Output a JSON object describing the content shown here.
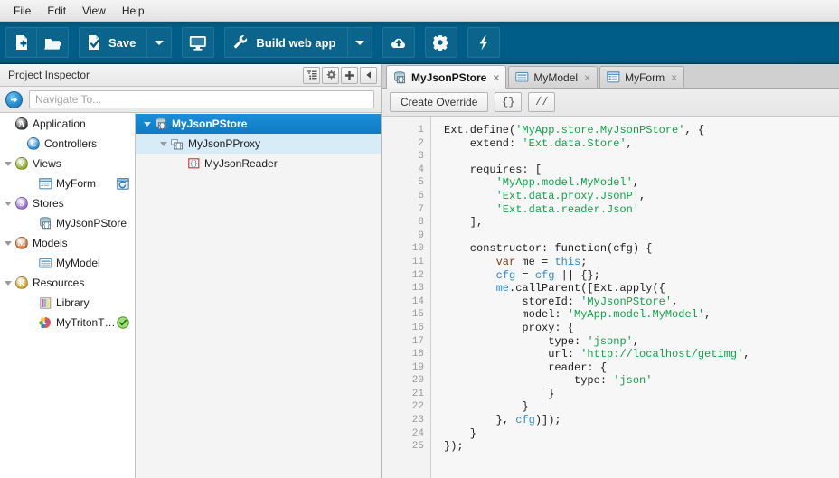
{
  "menubar": {
    "items": [
      "File",
      "Edit",
      "View",
      "Help"
    ]
  },
  "toolbar": {
    "groups": [
      {
        "buttons": [
          {
            "name": "new-file-button",
            "icon": "new-file-icon",
            "label": ""
          },
          {
            "name": "open-folder-button",
            "icon": "open-folder-icon",
            "label": ""
          }
        ]
      },
      {
        "buttons": [
          {
            "name": "save-button",
            "icon": "save-icon",
            "label": "Save"
          },
          {
            "name": "save-dropdown-button",
            "icon": "chevron-down-icon",
            "label": ""
          }
        ]
      },
      {
        "buttons": [
          {
            "name": "preview-button",
            "icon": "monitor-icon",
            "label": ""
          }
        ]
      },
      {
        "buttons": [
          {
            "name": "build-button",
            "icon": "wrench-icon",
            "label": "Build web app"
          },
          {
            "name": "build-dropdown-button",
            "icon": "chevron-down-icon",
            "label": ""
          }
        ]
      },
      {
        "buttons": [
          {
            "name": "deploy-button",
            "icon": "cloud-upload-icon",
            "label": ""
          }
        ]
      },
      {
        "buttons": [
          {
            "name": "settings-button",
            "icon": "gear-icon",
            "label": ""
          }
        ]
      },
      {
        "buttons": [
          {
            "name": "run-button",
            "icon": "lightning-icon",
            "label": ""
          }
        ]
      }
    ],
    "save_label": "Save",
    "build_label": "Build web app"
  },
  "inspector": {
    "title": "Project Inspector",
    "tools": [
      {
        "name": "filter-list-icon",
        "tip": "Filter"
      },
      {
        "name": "gear-icon",
        "tip": "Settings"
      },
      {
        "name": "plus-icon",
        "tip": "Add"
      },
      {
        "name": "collapse-left-icon",
        "tip": "Collapse"
      }
    ],
    "navigate": {
      "go_icon": "arrow-right-circle-icon",
      "placeholder": "Navigate To...",
      "value": ""
    },
    "tree": [
      {
        "label": "Application",
        "icon_letter": "A",
        "icon_color": "#3b3b3b",
        "indent": 0,
        "twisty": false,
        "type": "app"
      },
      {
        "label": "Controllers",
        "icon_letter": "C",
        "icon_color": "#2f8ed6",
        "indent": 1,
        "twisty": false,
        "type": "folder"
      },
      {
        "label": "Views",
        "icon_letter": "V",
        "icon_color": "#8fae24",
        "indent": 0,
        "twisty": true,
        "type": "folder"
      },
      {
        "label": "MyForm",
        "icon_letter": "",
        "icon_color": "",
        "indent": 2,
        "twisty": false,
        "type": "view",
        "badge": "refresh-window-icon"
      },
      {
        "label": "Stores",
        "icon_letter": "S",
        "icon_color": "#9b6fd0",
        "indent": 0,
        "twisty": true,
        "type": "folder"
      },
      {
        "label": "MyJsonPStore",
        "icon_letter": "",
        "icon_color": "",
        "indent": 2,
        "twisty": false,
        "type": "store"
      },
      {
        "label": "Models",
        "icon_letter": "M",
        "icon_color": "#cf7434",
        "indent": 0,
        "twisty": true,
        "type": "folder"
      },
      {
        "label": "MyModel",
        "icon_letter": "",
        "icon_color": "",
        "indent": 2,
        "twisty": false,
        "type": "model"
      },
      {
        "label": "Resources",
        "icon_letter": "R",
        "icon_color": "#cfa52a",
        "indent": 0,
        "twisty": true,
        "type": "folder"
      },
      {
        "label": "Library",
        "icon_letter": "",
        "icon_color": "",
        "indent": 2,
        "twisty": false,
        "type": "library"
      },
      {
        "label": "MyTritonThe...",
        "icon_letter": "",
        "icon_color": "",
        "indent": 2,
        "twisty": false,
        "type": "theme",
        "badge": "check-circle-icon"
      }
    ],
    "detail_tree": [
      {
        "label": "MyJsonPStore",
        "indent": 0,
        "twisty": true,
        "state": "selected",
        "icon": "store-icon"
      },
      {
        "label": "MyJsonPProxy",
        "indent": 1,
        "twisty": true,
        "state": "hover",
        "icon": "proxy-icon"
      },
      {
        "label": "MyJsonReader",
        "indent": 2,
        "twisty": false,
        "state": "normal",
        "icon": "reader-icon"
      }
    ]
  },
  "editor": {
    "tabs": [
      {
        "label": "MyJsonPStore",
        "icon": "store-icon",
        "active": true,
        "close": "×"
      },
      {
        "label": "MyModel",
        "icon": "model-icon",
        "active": false,
        "close": "×"
      },
      {
        "label": "MyForm",
        "icon": "view-icon",
        "active": false,
        "close": "×"
      }
    ],
    "toolbar": {
      "create_override": "Create Override",
      "braces": "{}",
      "comment": "//"
    },
    "line_count": 25,
    "line_numbers": [
      1,
      2,
      3,
      4,
      5,
      6,
      7,
      8,
      9,
      10,
      11,
      12,
      13,
      14,
      15,
      16,
      17,
      18,
      19,
      20,
      21,
      22,
      23,
      24,
      25
    ],
    "code_lines": [
      [
        {
          "t": "Ext.define(",
          "c": "p"
        },
        {
          "t": "'MyApp.store.MyJsonPStore'",
          "c": "s"
        },
        {
          "t": ", {",
          "c": "p"
        }
      ],
      [
        {
          "t": "    extend: ",
          "c": "p"
        },
        {
          "t": "'Ext.data.Store'",
          "c": "s"
        },
        {
          "t": ",",
          "c": "p"
        }
      ],
      [
        {
          "t": "",
          "c": "p"
        }
      ],
      [
        {
          "t": "    requires: [",
          "c": "p"
        }
      ],
      [
        {
          "t": "        ",
          "c": "p"
        },
        {
          "t": "'MyApp.model.MyModel'",
          "c": "s"
        },
        {
          "t": ",",
          "c": "p"
        }
      ],
      [
        {
          "t": "        ",
          "c": "p"
        },
        {
          "t": "'Ext.data.proxy.JsonP'",
          "c": "s"
        },
        {
          "t": ",",
          "c": "p"
        }
      ],
      [
        {
          "t": "        ",
          "c": "p"
        },
        {
          "t": "'Ext.data.reader.Json'",
          "c": "s"
        }
      ],
      [
        {
          "t": "    ],",
          "c": "p"
        }
      ],
      [
        {
          "t": "",
          "c": "p"
        }
      ],
      [
        {
          "t": "    constructor: function(cfg) {",
          "c": "p"
        }
      ],
      [
        {
          "t": "        ",
          "c": "p"
        },
        {
          "t": "var",
          "c": "k"
        },
        {
          "t": " me = ",
          "c": "p"
        },
        {
          "t": "this",
          "c": "v"
        },
        {
          "t": ";",
          "c": "p"
        }
      ],
      [
        {
          "t": "        ",
          "c": "p"
        },
        {
          "t": "cfg",
          "c": "v"
        },
        {
          "t": " = ",
          "c": "p"
        },
        {
          "t": "cfg",
          "c": "v"
        },
        {
          "t": " || {};",
          "c": "p"
        }
      ],
      [
        {
          "t": "        ",
          "c": "p"
        },
        {
          "t": "me",
          "c": "v"
        },
        {
          "t": ".callParent([Ext.apply({",
          "c": "p"
        }
      ],
      [
        {
          "t": "            storeId: ",
          "c": "p"
        },
        {
          "t": "'MyJsonPStore'",
          "c": "s"
        },
        {
          "t": ",",
          "c": "p"
        }
      ],
      [
        {
          "t": "            model: ",
          "c": "p"
        },
        {
          "t": "'MyApp.model.MyModel'",
          "c": "s"
        },
        {
          "t": ",",
          "c": "p"
        }
      ],
      [
        {
          "t": "            proxy: {",
          "c": "p"
        }
      ],
      [
        {
          "t": "                type: ",
          "c": "p"
        },
        {
          "t": "'jsonp'",
          "c": "s"
        },
        {
          "t": ",",
          "c": "p"
        }
      ],
      [
        {
          "t": "                url: ",
          "c": "p"
        },
        {
          "t": "'http://localhost/getimg'",
          "c": "s"
        },
        {
          "t": ",",
          "c": "p"
        }
      ],
      [
        {
          "t": "                reader: {",
          "c": "p"
        }
      ],
      [
        {
          "t": "                    type: ",
          "c": "p"
        },
        {
          "t": "'json'",
          "c": "s"
        }
      ],
      [
        {
          "t": "                }",
          "c": "p"
        }
      ],
      [
        {
          "t": "            }",
          "c": "p"
        }
      ],
      [
        {
          "t": "        }, ",
          "c": "p"
        },
        {
          "t": "cfg",
          "c": "v"
        },
        {
          "t": ")]);",
          "c": "p"
        }
      ],
      [
        {
          "t": "    }",
          "c": "p"
        }
      ],
      [
        {
          "t": "});",
          "c": "p"
        }
      ]
    ]
  },
  "colors": {
    "toolbar_bg": "#005d87",
    "selection_blue": "#0f7bc4",
    "hover_blue": "#d8ecf8",
    "string_green": "#11a24a",
    "identifier_blue": "#2b8bd6",
    "keyword_brown": "#7a3a12",
    "tabstrip_gray": "#d0d0d0",
    "code_bg": "#f7f7f7"
  }
}
